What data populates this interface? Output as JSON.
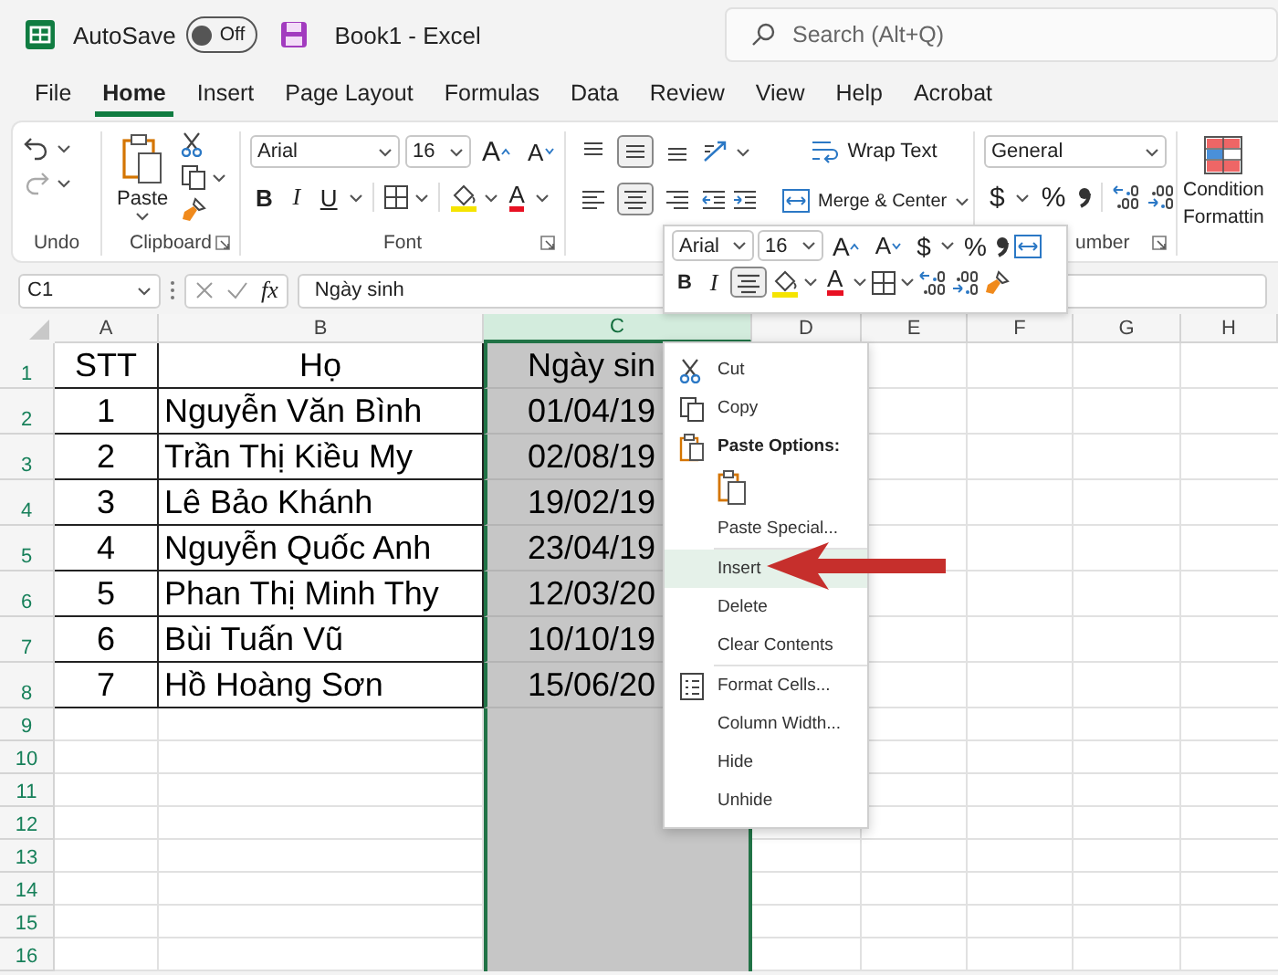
{
  "title_bar": {
    "autosave_label": "AutoSave",
    "autosave": {
      "on": false,
      "label": "Off"
    },
    "title": "Book1  -  Excel",
    "search": {
      "placeholder": "Search (Alt+Q)"
    }
  },
  "menu_tabs": [
    {
      "label": "File",
      "selected": false
    },
    {
      "label": "Home",
      "selected": true
    },
    {
      "label": "Insert",
      "selected": false
    },
    {
      "label": "Page Layout",
      "selected": false
    },
    {
      "label": "Formulas",
      "selected": false
    },
    {
      "label": "Data",
      "selected": false
    },
    {
      "label": "Review",
      "selected": false
    },
    {
      "label": "View",
      "selected": false
    },
    {
      "label": "Help",
      "selected": false
    },
    {
      "label": "Acrobat",
      "selected": false
    }
  ],
  "ribbon": {
    "undo": {
      "label": "Undo"
    },
    "clipboard": {
      "paste": "Paste",
      "label": "Clipboard"
    },
    "font": {
      "font_name": "Arial",
      "font_size": "16",
      "grow": "A",
      "shrink": "A",
      "bold": "B",
      "italic": "I",
      "underline": "U",
      "font_color": "A",
      "label": "Font"
    },
    "alignment": {
      "vertical": [
        {
          "selected": false
        },
        {
          "selected": true
        },
        {
          "selected": false
        }
      ],
      "horizontal": [
        {
          "selected": false
        },
        {
          "selected": true
        },
        {
          "selected": false
        }
      ],
      "wrap_text": "Wrap Text",
      "merge_center": "Merge & Center"
    },
    "number": {
      "format": "General",
      "currency": "$",
      "percent": "%",
      "label": "umber"
    },
    "styles": {
      "conditional_formatting": [
        "Condition",
        "Formattin"
      ]
    }
  },
  "formula_bar": {
    "name_box": "C1",
    "function": "fx",
    "value": "Ngày sinh"
  },
  "sheet": {
    "columns": [
      {
        "label": "A",
        "selected": false
      },
      {
        "label": "B",
        "selected": false
      },
      {
        "label": "C",
        "selected": true
      },
      {
        "label": "D",
        "selected": false
      },
      {
        "label": "E",
        "selected": false
      },
      {
        "label": "F",
        "selected": false
      },
      {
        "label": "G",
        "selected": false
      },
      {
        "label": "H",
        "selected": false
      }
    ],
    "rows": [
      {
        "number": "1",
        "kind": "header",
        "cells": [
          "STT",
          "Họ",
          "Ngày sin"
        ]
      },
      {
        "number": "2",
        "kind": "data",
        "cells": [
          "1",
          "Nguyễn Văn Bình",
          "01/04/19"
        ]
      },
      {
        "number": "3",
        "kind": "data",
        "cells": [
          "2",
          "Trần Thị Kiều My",
          "02/08/19"
        ]
      },
      {
        "number": "4",
        "kind": "data",
        "cells": [
          "3",
          "Lê Bảo Khánh",
          "19/02/19"
        ]
      },
      {
        "number": "5",
        "kind": "data",
        "cells": [
          "4",
          "Nguyễn Quốc Anh",
          "23/04/19"
        ]
      },
      {
        "number": "6",
        "kind": "data",
        "cells": [
          "5",
          "Phan Thị Minh Thy",
          "12/03/20"
        ]
      },
      {
        "number": "7",
        "kind": "data",
        "cells": [
          "6",
          "Bùi Tuấn Vũ",
          "10/10/19"
        ]
      },
      {
        "number": "8",
        "kind": "data",
        "cells": [
          "7",
          "Hồ Hoàng Sơn",
          "15/06/20"
        ]
      },
      {
        "number": "9",
        "kind": "empty"
      },
      {
        "number": "10",
        "kind": "empty"
      },
      {
        "number": "11",
        "kind": "empty"
      },
      {
        "number": "12",
        "kind": "empty"
      },
      {
        "number": "13",
        "kind": "empty"
      },
      {
        "number": "14",
        "kind": "empty"
      },
      {
        "number": "15",
        "kind": "empty"
      },
      {
        "number": "16",
        "kind": "empty"
      }
    ]
  },
  "mini_toolbar": {
    "font_name": "Arial",
    "font_size": "16",
    "grow": "A",
    "shrink": "A",
    "currency": "$",
    "percent": "%",
    "bold": "B",
    "italic": "I",
    "align_center": {
      "selected": true
    },
    "font_color": "A"
  },
  "context_menu": {
    "items": [
      {
        "kind": "cut",
        "label": "Cut",
        "selected": false
      },
      {
        "kind": "copy",
        "label": "Copy",
        "selected": false
      },
      {
        "kind": "heading",
        "label": "Paste Options:"
      },
      {
        "kind": "paste",
        "selected": false
      },
      {
        "kind": "plain",
        "label": "Paste Special...",
        "selected": false
      },
      {
        "kind": "plain",
        "label": "Insert",
        "selected": true,
        "divider_above": true
      },
      {
        "kind": "plain",
        "label": "Delete",
        "selected": false
      },
      {
        "kind": "plain",
        "label": "Clear Contents",
        "selected": false
      },
      {
        "kind": "format",
        "label": "Format Cells...",
        "selected": false,
        "divider_above": true
      },
      {
        "kind": "plain",
        "label": "Column Width...",
        "selected": false
      },
      {
        "kind": "plain",
        "label": "Hide",
        "selected": false
      },
      {
        "kind": "plain",
        "label": "Unhide",
        "selected": false
      }
    ]
  }
}
